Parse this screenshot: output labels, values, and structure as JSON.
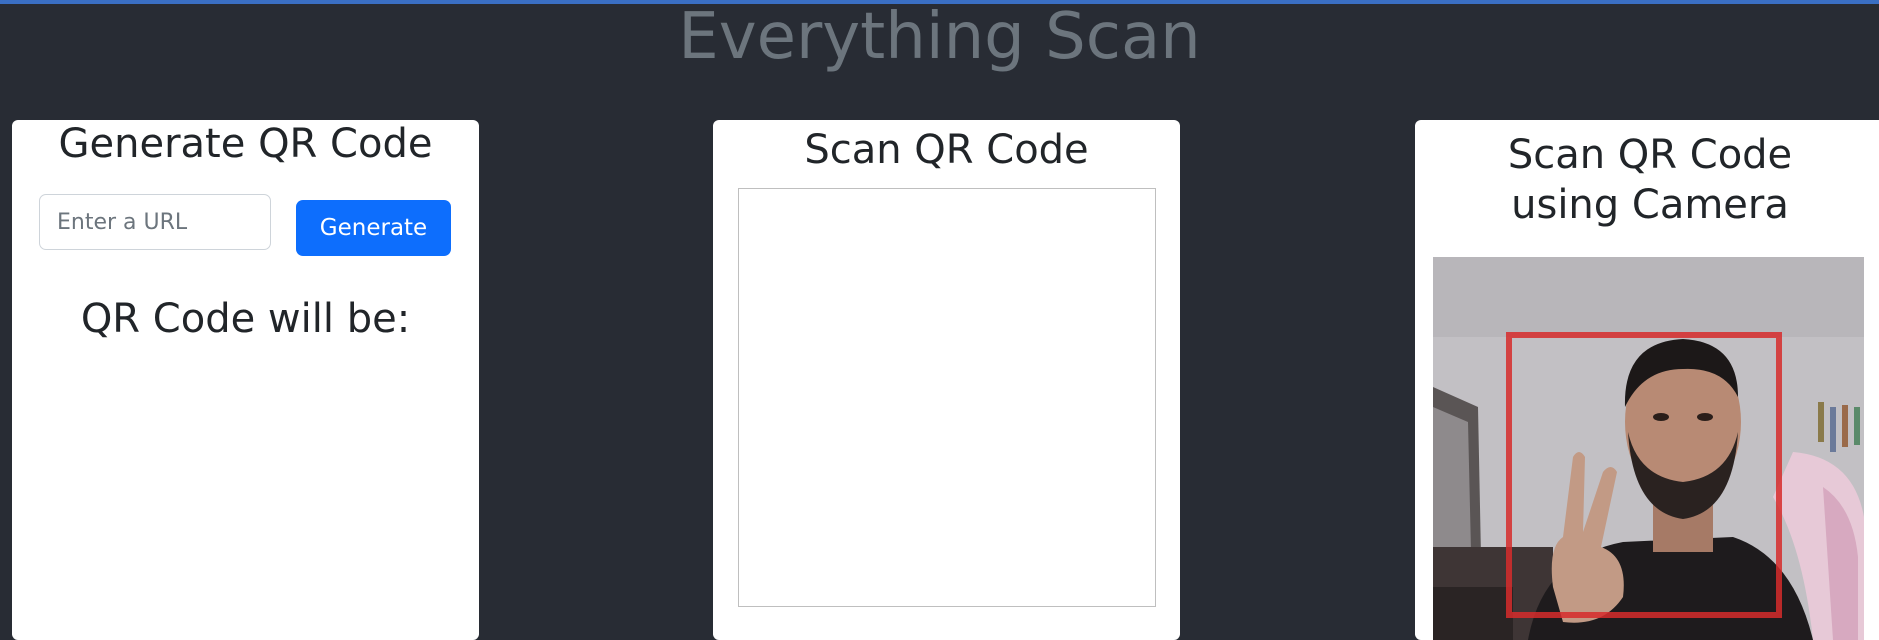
{
  "app": {
    "title": "Everything Scan"
  },
  "generate": {
    "title": "Generate QR Code",
    "input_placeholder": "Enter a URL",
    "input_value": "",
    "button_label": "Generate",
    "result_heading": "QR Code will be:"
  },
  "scan": {
    "title": "Scan QR Code"
  },
  "camera": {
    "title_line1": "Scan QR Code",
    "title_line2": "using Camera"
  },
  "colors": {
    "background": "#282c34",
    "accent_bar": "#3a6fc4",
    "title_text": "#6c757d",
    "primary_button": "#0d6efd",
    "scan_frame": "#d62b2b"
  }
}
